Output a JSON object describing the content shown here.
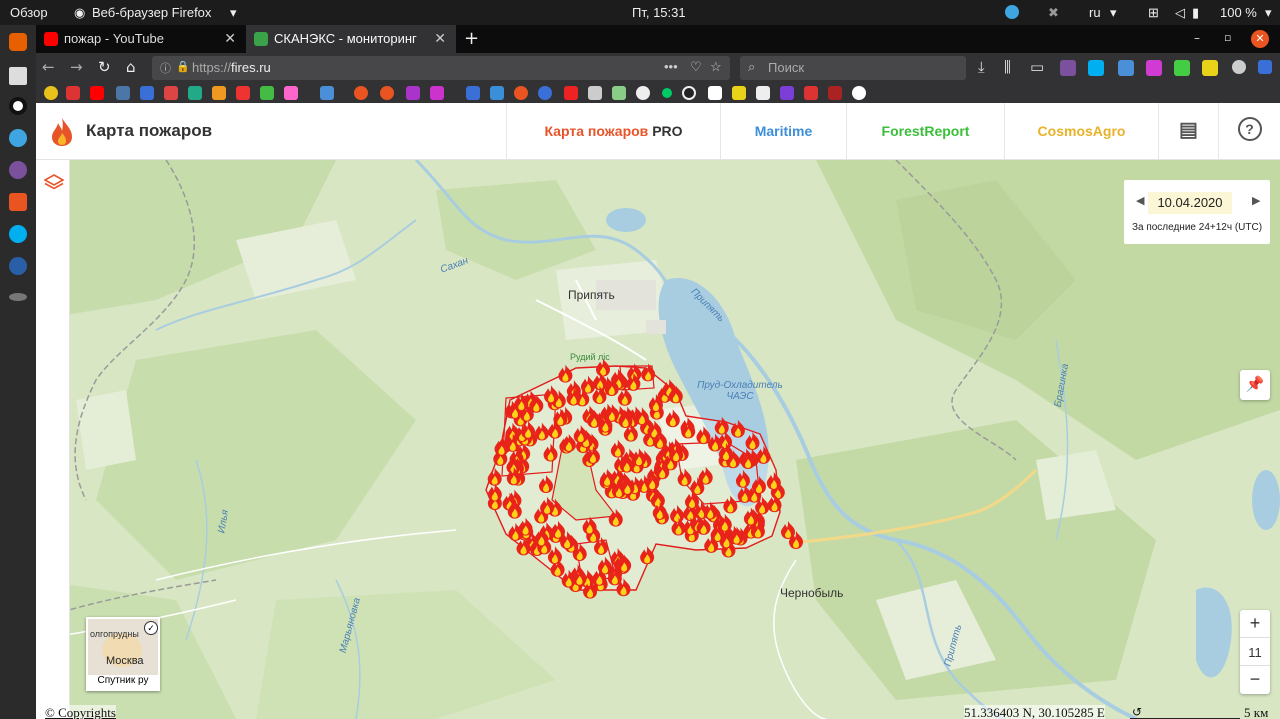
{
  "os": {
    "activities": "Обзор",
    "app_name": "Веб-браузер Firefox",
    "clock": "Пт, 15:31",
    "keyboard_layout": "ru",
    "battery": "100 %"
  },
  "browser": {
    "tabs": [
      {
        "label": "пожар - YouTube",
        "active": false
      },
      {
        "label": "СКАНЭКС - мониторинг",
        "active": true
      }
    ],
    "url_prefix": "https://",
    "url_host": "fires.ru",
    "search_placeholder": "Поиск"
  },
  "site": {
    "title": "Карта пожаров",
    "nav": [
      {
        "label": "Карта пожаров",
        "suffix": "PRO",
        "color": "#e8542a"
      },
      {
        "label": "Maritime",
        "suffix": "",
        "color": "#3c8fd8"
      },
      {
        "label": "ForestReport",
        "suffix": "",
        "color": "#3bbf3b"
      },
      {
        "label": "CosmosAgro",
        "suffix": "",
        "color": "#e8b22a"
      }
    ]
  },
  "map": {
    "date": "10.04.2020",
    "period": "За последние 24+12ч (UTC)",
    "zoom_level": "11",
    "zoom_in": "+",
    "zoom_out": "−",
    "labels": {
      "pripyat_city": "Припять",
      "rudiy_lis": "Рудий ліс",
      "cooling_pond": "Пруд-Охладитель ЧАЭС",
      "chernobyl": "Чернобыль",
      "sakhan": "Сахан",
      "pripyat_river": "Припять",
      "braginka": "Брагинка",
      "ilya": "Илья",
      "maryanovka": "Марьяновка",
      "pripyat_river_south": "Припять"
    },
    "minimap": {
      "city": "Москва",
      "top_text": "олгопрудны",
      "caption": "Спутник ру"
    },
    "copyright": "© Copyrights",
    "coords": "51.336403 N, 30.105285 E",
    "scale_label": "5 км"
  }
}
